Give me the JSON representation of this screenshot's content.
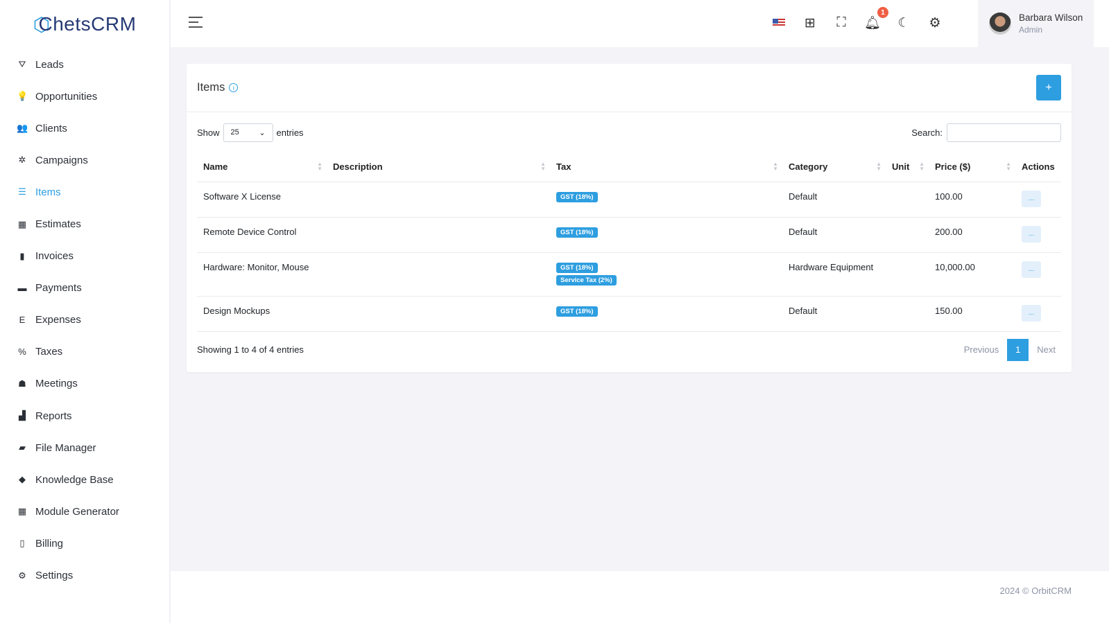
{
  "brand": {
    "logo": "ChetsCRM"
  },
  "sidebar": {
    "items": [
      {
        "label": "Leads",
        "icon": "filter-icon",
        "glyph": "⛛"
      },
      {
        "label": "Opportunities",
        "icon": "lightbulb-icon",
        "glyph": "💡"
      },
      {
        "label": "Clients",
        "icon": "users-icon",
        "glyph": "👥"
      },
      {
        "label": "Campaigns",
        "icon": "gears-icon",
        "glyph": "✲"
      },
      {
        "label": "Items",
        "icon": "list-icon",
        "glyph": "☰",
        "active": true
      },
      {
        "label": "Estimates",
        "icon": "calculator-icon",
        "glyph": "▦"
      },
      {
        "label": "Invoices",
        "icon": "file-icon",
        "glyph": "▮"
      },
      {
        "label": "Payments",
        "icon": "credit-card-icon",
        "glyph": "▬"
      },
      {
        "label": "Expenses",
        "icon": "expense-icon",
        "glyph": "E"
      },
      {
        "label": "Taxes",
        "icon": "percent-icon",
        "glyph": "%"
      },
      {
        "label": "Meetings",
        "icon": "meeting-icon",
        "glyph": "☗"
      },
      {
        "label": "Reports",
        "icon": "chart-icon",
        "glyph": "▟"
      },
      {
        "label": "File Manager",
        "icon": "folder-icon",
        "glyph": "▰"
      },
      {
        "label": "Knowledge Base",
        "icon": "graduation-cap-icon",
        "glyph": "◆"
      },
      {
        "label": "Module Generator",
        "icon": "table-icon",
        "glyph": "▦"
      },
      {
        "label": "Billing",
        "icon": "file-outline-icon",
        "glyph": "▯"
      },
      {
        "label": "Settings",
        "icon": "gear-icon",
        "glyph": "⚙"
      }
    ]
  },
  "header": {
    "notifications": "1",
    "user": {
      "name": "Barbara Wilson",
      "role": "Admin"
    }
  },
  "card": {
    "title": "Items",
    "add_label": "+",
    "show": "Show",
    "entries_value": "25",
    "entries": "entries",
    "search_label": "Search:",
    "search_value": ""
  },
  "table": {
    "columns": [
      "Name",
      "Description",
      "Tax",
      "Category",
      "Unit",
      "Price ($)",
      "Actions"
    ],
    "rows": [
      {
        "name": "Software X License",
        "description": "",
        "taxes": [
          "GST (18%)"
        ],
        "category": "Default",
        "unit": "",
        "price": "100.00",
        "action": "..."
      },
      {
        "name": "Remote Device Control",
        "description": "",
        "taxes": [
          "GST (18%)"
        ],
        "category": "Default",
        "unit": "",
        "price": "200.00",
        "action": "..."
      },
      {
        "name": "Hardware: Monitor, Mouse",
        "description": "",
        "taxes": [
          "GST (18%)",
          "Service Tax (2%)"
        ],
        "category": "Hardware Equipment",
        "unit": "",
        "price": "10,000.00",
        "action": "..."
      },
      {
        "name": "Design Mockups",
        "description": "",
        "taxes": [
          "GST (18%)"
        ],
        "category": "Default",
        "unit": "",
        "price": "150.00",
        "action": "..."
      }
    ]
  },
  "pagination": {
    "summary": "Showing 1 to 4 of 4 entries",
    "previous": "Previous",
    "current": "1",
    "next": "Next"
  },
  "footer": {
    "text": "2024 © OrbitCRM"
  },
  "colors": {
    "accent": "#2d9ee0",
    "badge": "#ef5e44",
    "brand": "#263a75"
  }
}
